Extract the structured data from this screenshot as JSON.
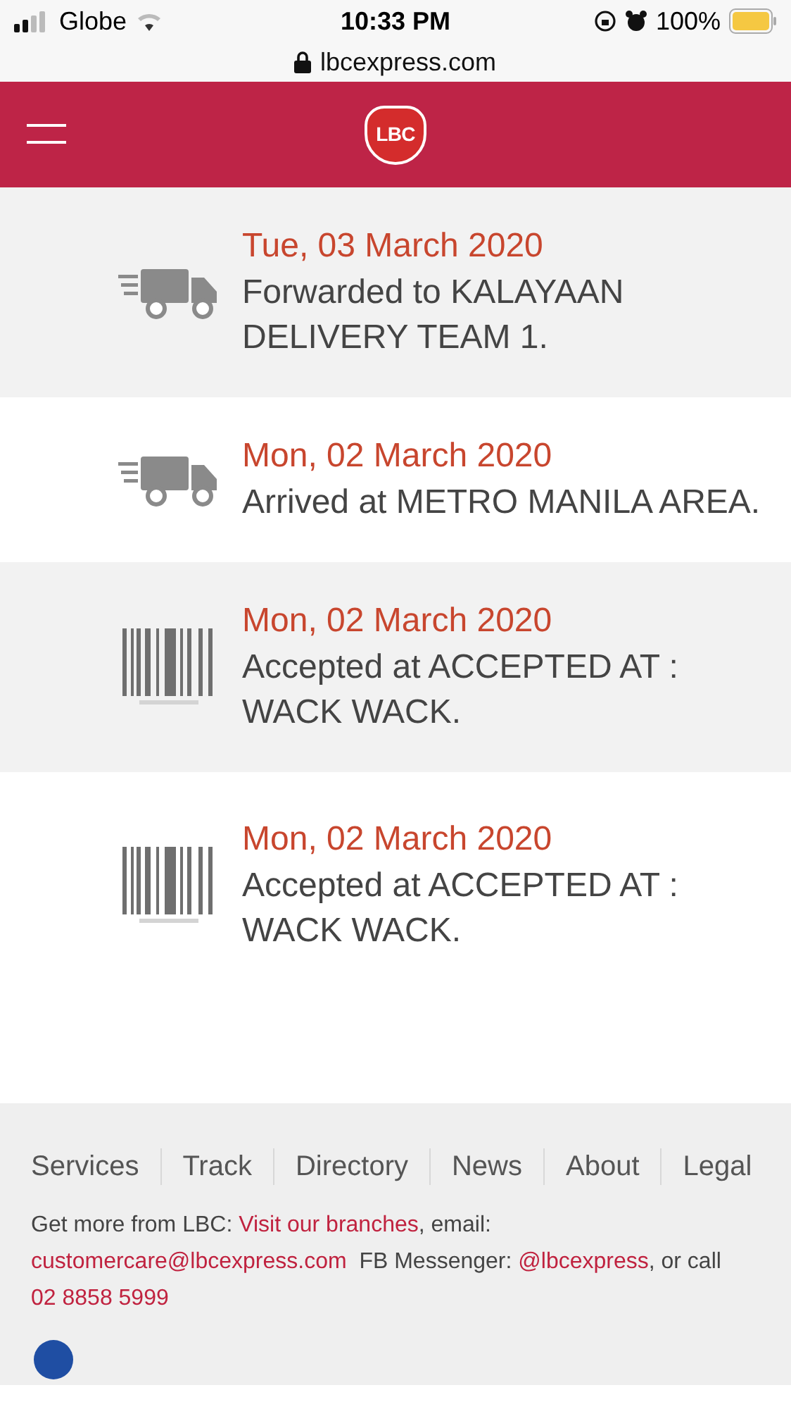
{
  "status_bar": {
    "carrier": "Globe",
    "time": "10:33 PM",
    "battery": "100%"
  },
  "address_bar": {
    "url": "lbcexpress.com"
  },
  "header": {
    "logo": "LBC"
  },
  "events": [
    {
      "kind": "truck",
      "date": "Tue, 03 March 2020",
      "text": "Forwarded to KALAYAAN DELIVERY TEAM 1."
    },
    {
      "kind": "truck",
      "date": "Mon, 02 March 2020",
      "text": "Arrived at METRO MANILA AREA."
    },
    {
      "kind": "barcode",
      "date": "Mon, 02 March 2020",
      "text": "Accepted at ACCEPTED AT : WACK WACK."
    },
    {
      "kind": "barcode",
      "date": "Mon, 02 March 2020",
      "text": "Accepted at ACCEPTED AT : WACK WACK."
    }
  ],
  "footer": {
    "links": [
      "Services",
      "Track",
      "Directory",
      "News",
      "About",
      "Legal"
    ],
    "intro": "Get more from LBC: ",
    "branches_link": "Visit our branches",
    "email_label": ", email:",
    "email": "customercare@lbcexpress.com",
    "fb_label": "FB Messenger: ",
    "fb_link": "@lbcexpress",
    "call_label": ", or call",
    "phone": "02 8858 5999"
  }
}
